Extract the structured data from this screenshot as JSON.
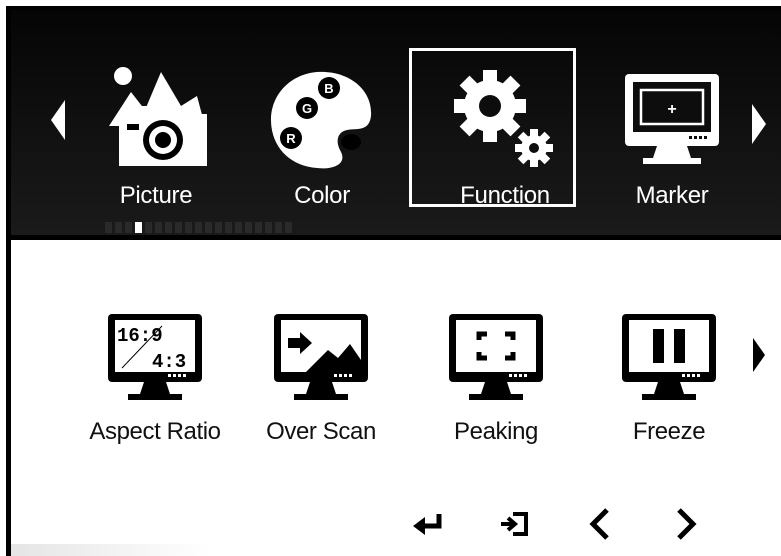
{
  "menu": {
    "items": [
      {
        "label": "Picture",
        "icon": "picture-icon"
      },
      {
        "label": "Color",
        "icon": "palette-icon"
      },
      {
        "label": "Function",
        "icon": "gears-icon",
        "selected": true
      },
      {
        "label": "Marker",
        "icon": "monitor-marker-icon"
      }
    ],
    "palette_letters": [
      "B",
      "G",
      "R"
    ]
  },
  "submenu": {
    "items": [
      {
        "label": "Aspect Ratio",
        "icon": "aspect-ratio-icon",
        "screen_text_top": "16:9",
        "screen_text_bottom": "4:3"
      },
      {
        "label": "Over Scan",
        "icon": "over-scan-icon"
      },
      {
        "label": "Peaking",
        "icon": "peaking-icon"
      },
      {
        "label": "Freeze",
        "icon": "freeze-icon"
      }
    ]
  },
  "key_hints": [
    "enter-icon",
    "exit-icon",
    "left-icon",
    "right-icon"
  ],
  "colors": {
    "bar_background": "#0d0d0d",
    "foreground": "#ffffff",
    "panel_background": "#ffffff",
    "panel_foreground": "#000000"
  }
}
